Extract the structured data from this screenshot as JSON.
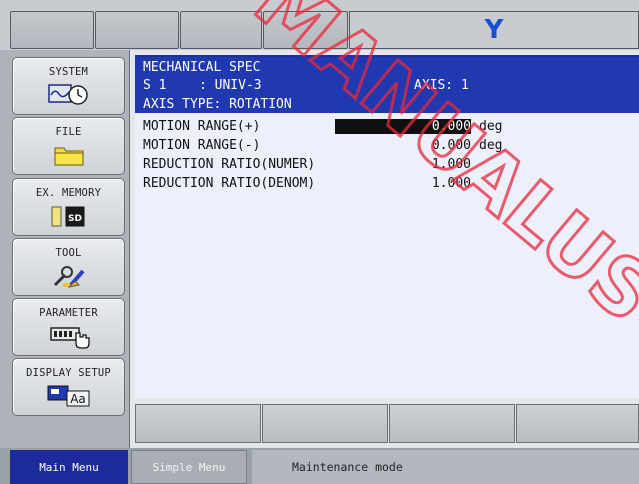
{
  "top_bar": {
    "y_indicator": "Y"
  },
  "side_menu": {
    "items": [
      {
        "label": "SYSTEM",
        "icon": "system-clock-icon"
      },
      {
        "label": "FILE",
        "icon": "folder-icon"
      },
      {
        "label": "EX. MEMORY",
        "icon": "sd-card-icon"
      },
      {
        "label": "TOOL",
        "icon": "tool-icon"
      },
      {
        "label": "PARAMETER",
        "icon": "parameter-hand-icon"
      },
      {
        "label": "DISPLAY SETUP",
        "icon": "display-setup-icon"
      }
    ]
  },
  "screen": {
    "title": "MECHANICAL SPEC",
    "s_label": "S 1",
    "s_value": ": UNIV-3",
    "axis": "AXIS: 1",
    "axis_type": "AXIS TYPE: ROTATION",
    "rows": [
      {
        "label": "MOTION RANGE(+)",
        "value": "0.000",
        "unit": "deg",
        "selected": true
      },
      {
        "label": "MOTION RANGE(-)",
        "value": "0.000",
        "unit": "deg",
        "selected": false
      },
      {
        "label": "REDUCTION RATIO(NUMER)",
        "value": "1.000",
        "unit": "",
        "selected": false
      },
      {
        "label": "REDUCTION RATIO(DENOM)",
        "value": "1.000",
        "unit": "",
        "selected": false
      }
    ]
  },
  "status_bar": {
    "main_menu": "Main Menu",
    "simple_menu": "Simple Menu",
    "message": "Maintenance mode"
  },
  "watermark": {
    "text": "MANUALUSE",
    "color": "#e8283c"
  },
  "colors": {
    "header_blue": "#2038b0",
    "panel_bg": "#edf0fb",
    "y_blue": "#1a4fd0",
    "main_tab": "#1d2a9c"
  }
}
